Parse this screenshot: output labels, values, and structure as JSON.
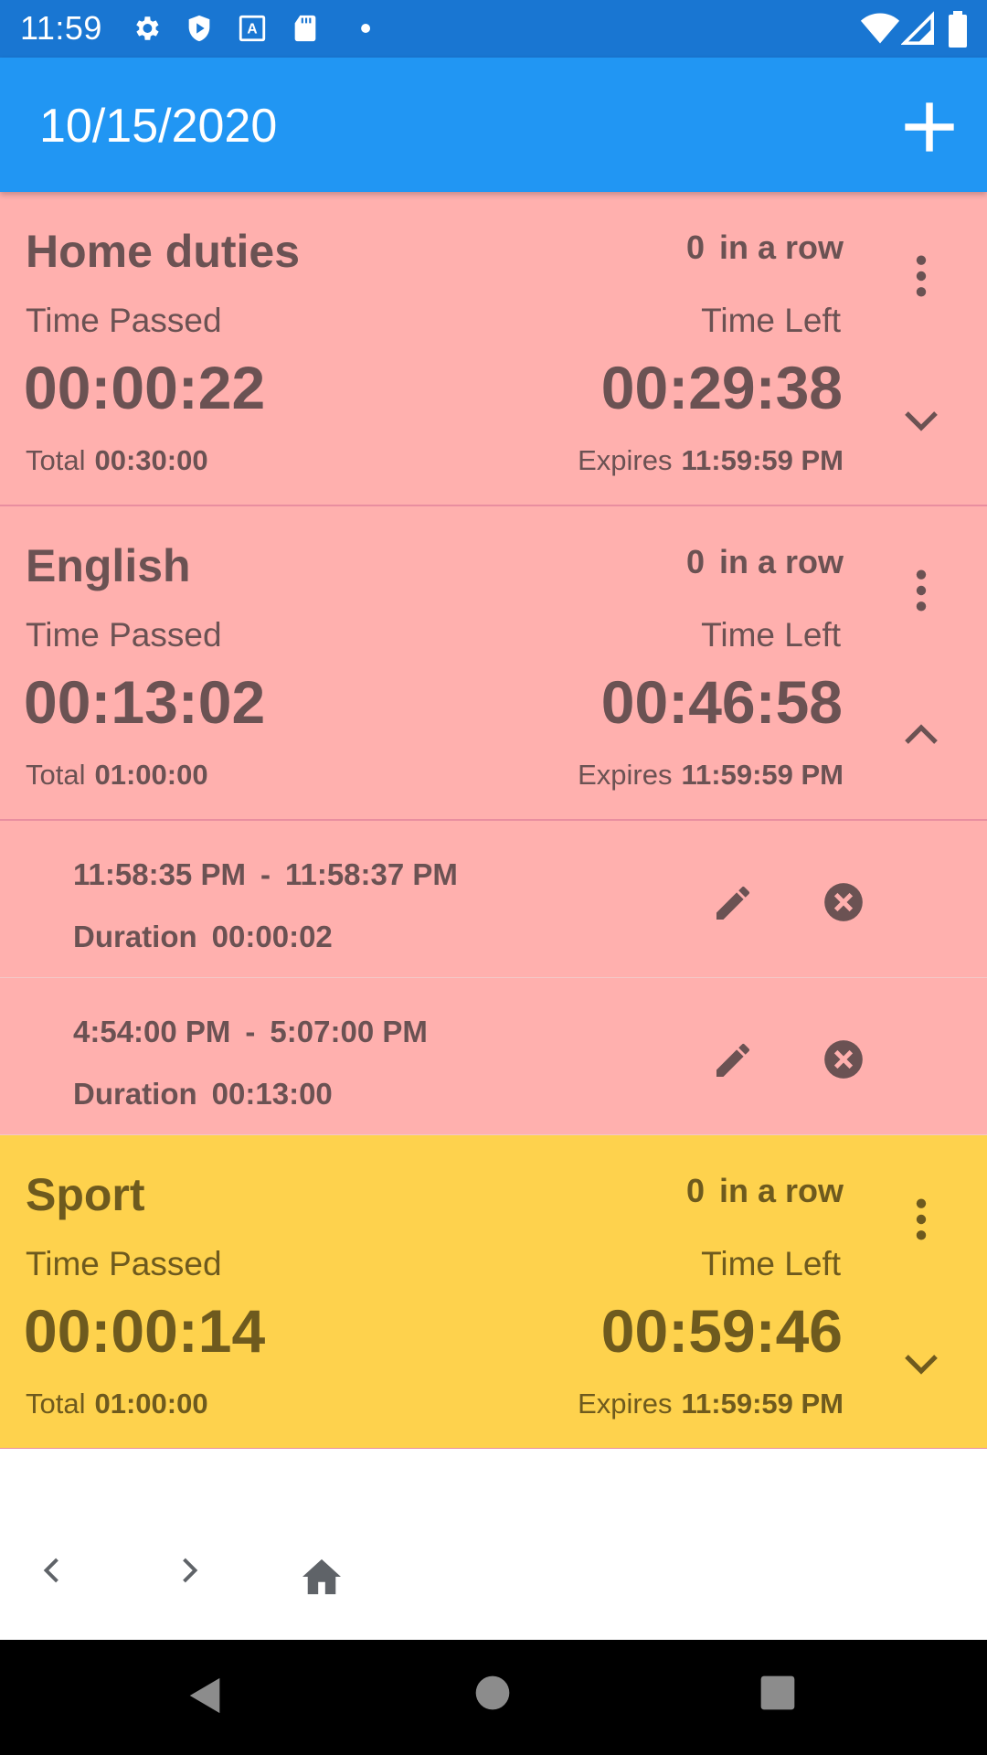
{
  "status_bar": {
    "time": "11:59",
    "icons": [
      "gear-icon",
      "shield-icon",
      "font-icon",
      "sd-card-icon",
      "dot-icon"
    ],
    "right_icons": [
      "wifi-icon",
      "cell-signal-icon",
      "battery-icon"
    ]
  },
  "app_bar": {
    "date": "10/15/2020",
    "add_icon": "plus-icon"
  },
  "tasks": [
    {
      "name": "Home duties",
      "streak_count": "0",
      "streak_label": "in a row",
      "time_passed_label": "Time Passed",
      "time_passed": "00:00:22",
      "time_left_label": "Time Left",
      "time_left": "00:29:38",
      "total_label": "Total",
      "total": "00:30:00",
      "expires_label": "Expires",
      "expires": "11:59:59 PM",
      "color": "#ffb0ae",
      "text_color": "#6b5253",
      "expanded": false
    },
    {
      "name": "English",
      "streak_count": "0",
      "streak_label": "in a row",
      "time_passed_label": "Time Passed",
      "time_passed": "00:13:02",
      "time_left_label": "Time Left",
      "time_left": "00:46:58",
      "total_label": "Total",
      "total": "01:00:00",
      "expires_label": "Expires",
      "expires": "11:59:59 PM",
      "color": "#ffb0ae",
      "text_color": "#6b5253",
      "expanded": true,
      "sessions": [
        {
          "start": "11:58:35 PM",
          "separator": "-",
          "end": "11:58:37 PM",
          "duration_label": "Duration",
          "duration": "00:00:02"
        },
        {
          "start": "4:54:00 PM",
          "separator": "-",
          "end": "5:07:00 PM",
          "duration_label": "Duration",
          "duration": "00:13:00"
        }
      ]
    },
    {
      "name": "Sport",
      "streak_count": "0",
      "streak_label": "in a row",
      "time_passed_label": "Time Passed",
      "time_passed": "00:00:14",
      "time_left_label": "Time Left",
      "time_left": "00:59:46",
      "total_label": "Total",
      "total": "01:00:00",
      "expires_label": "Expires",
      "expires": "11:59:59 PM",
      "color": "#fed24d",
      "text_color": "#6e5a1e",
      "expanded": false
    }
  ],
  "bottom_nav": [
    "chevron-left-icon",
    "chevron-right-icon",
    "home-icon"
  ],
  "system_nav": [
    "back-icon",
    "home-circle-icon",
    "recents-icon"
  ]
}
